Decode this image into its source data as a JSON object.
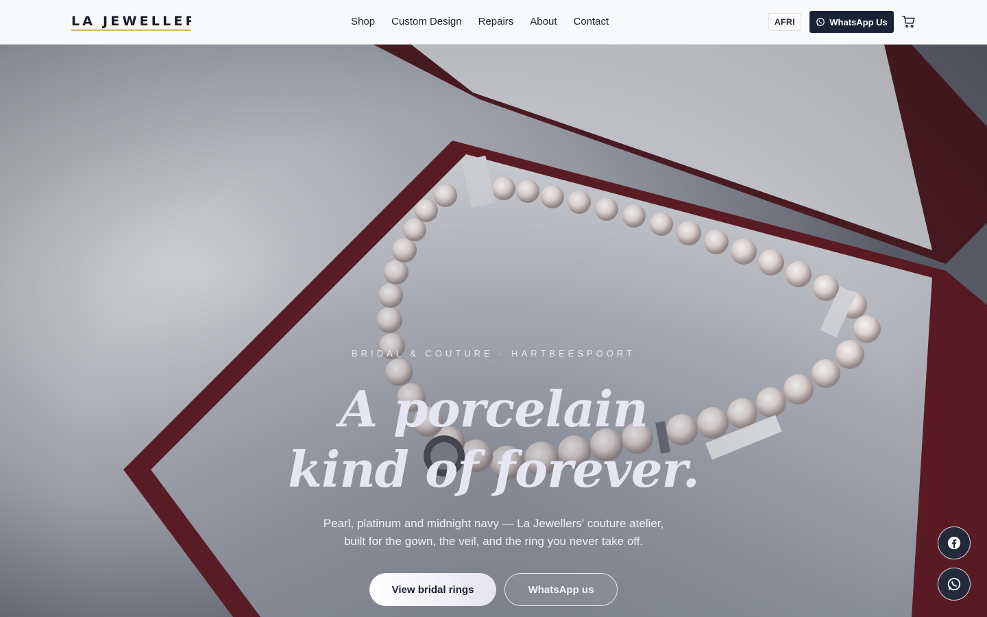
{
  "header": {
    "logo": "LA JEWELLERS",
    "nav": [
      "Shop",
      "Custom Design",
      "Repairs",
      "About",
      "Contact"
    ],
    "lang_label": "AFRI",
    "whatsapp_label": "WhatsApp Us"
  },
  "hero": {
    "eyebrow": "BRIDAL & COUTURE · HARTBEESPOORT",
    "headline_line1": "A porcelain",
    "headline_line2": "kind of forever.",
    "subtext_line1": "Pearl, platinum and midnight navy — La Jewellers' couture atelier,",
    "subtext_line2": "built for the gown, the veil, and the ring you never take off.",
    "primary_cta": "View bridal rings",
    "secondary_cta": "WhatsApp us"
  },
  "floating": {
    "facebook_icon": "facebook-icon",
    "whatsapp_icon": "whatsapp-icon"
  },
  "colors": {
    "navy": "#1b2236",
    "gold_underline": "#d7b464",
    "headline": "#e6e6f3"
  }
}
